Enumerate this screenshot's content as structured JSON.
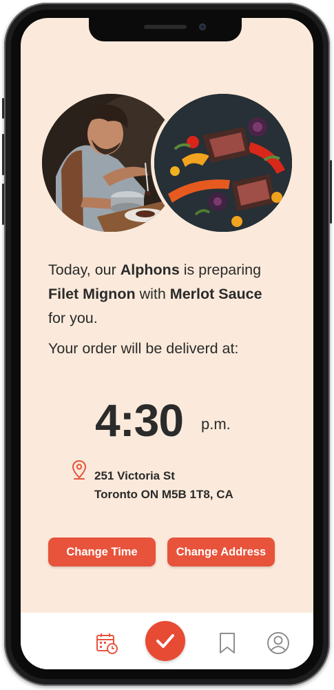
{
  "photos": {
    "chef_icon": "chef-photo",
    "steak_icon": "filet-mignon-photo"
  },
  "intro": {
    "prefix": "Today, our ",
    "chef_name": "Alphons",
    "middle": " is preparing",
    "dish": "Filet Mignon",
    "with": " with ",
    "sauce": "Merlot Sauce",
    "suffix": "for you."
  },
  "delivery": {
    "label": "Your order will be deliverd at:",
    "time": "4:30",
    "ampm": "p.m."
  },
  "address": {
    "line1": "251 Victoria St",
    "line2": "Toronto ON M5B 1T8, CA",
    "icon": "location-pin-icon"
  },
  "buttons": {
    "change_time": "Change Time",
    "change_address": "Change Address"
  },
  "tabbar": {
    "items": [
      "calendar-clock-icon",
      "check-icon",
      "bookmark-icon",
      "profile-icon"
    ]
  },
  "colors": {
    "accent": "#e8533b",
    "background": "#fbeadb",
    "text": "#2a2a2a"
  }
}
